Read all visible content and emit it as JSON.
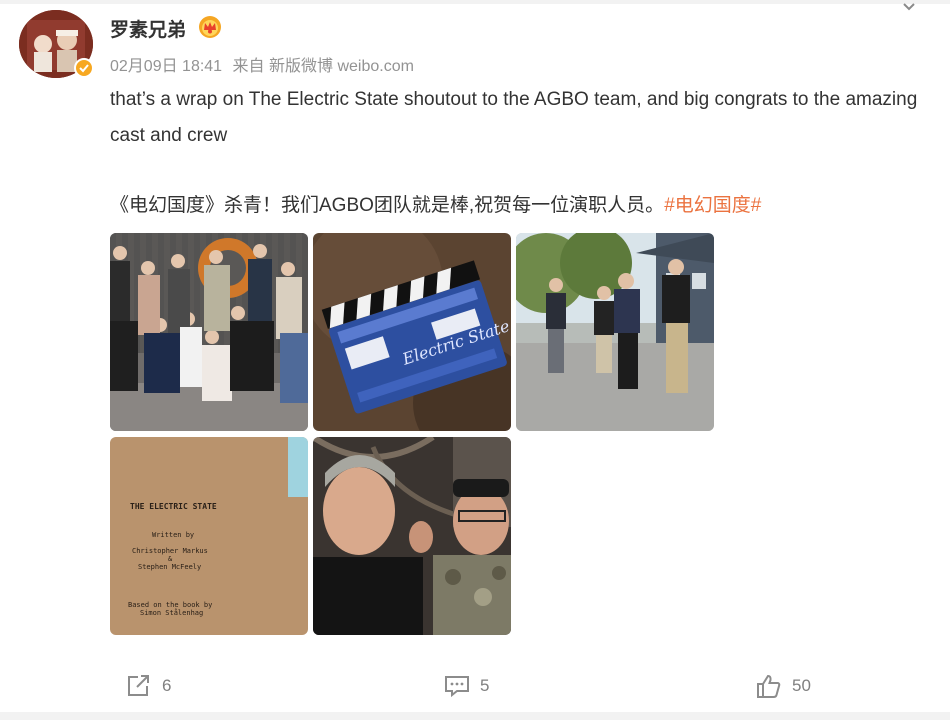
{
  "post": {
    "username": "罗素兄弟",
    "date": "02月09日 18:41",
    "source": "来自 新版微博 weibo.com",
    "text_en": "that’s a wrap on The Electric State shoutout to the AGBO team, and big congrats to the amazing cast and crew",
    "text_zh": "《电幻国度》杀青！我们AGBO团队就是棒,祝贺每一位演职人员。",
    "hashtag": "#电幻国度#"
  },
  "images": [
    {
      "desc": "group-photo-cast-crew"
    },
    {
      "desc": "film-clapperboard",
      "clapper_text": "Electric State"
    },
    {
      "desc": "street-group-photo"
    },
    {
      "desc": "script-title-page",
      "script_lines": [
        "THE ELECTRIC STATE",
        "Written by",
        "Christopher Markus",
        "&",
        "Stephen McFeely",
        "Based on the book by",
        "Simon Stålenhag"
      ]
    },
    {
      "desc": "selfie-two-men"
    }
  ],
  "actions": {
    "repost_count": "6",
    "comment_count": "5",
    "like_count": "50"
  },
  "colors": {
    "hashtag": "#eb7340",
    "meta": "#939393",
    "verified": "#f7a821"
  }
}
